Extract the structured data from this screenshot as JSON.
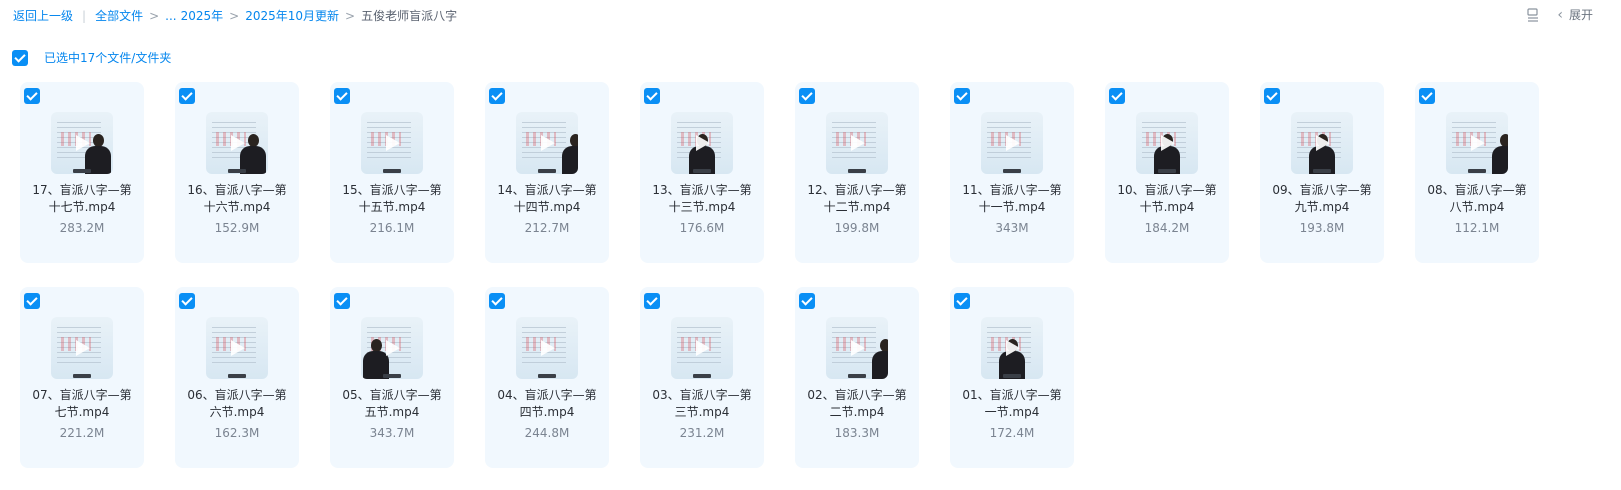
{
  "breadcrumb": {
    "back": "返回上一级",
    "all_files": "全部文件",
    "sep": ">",
    "ellipsis": "...",
    "year": "2025年",
    "month": "2025年10月更新",
    "current": "五俊老师盲派八字"
  },
  "toolbar": {
    "view_icon": "list-view-icon",
    "expand_chevron": "‹",
    "expand_label": "展开"
  },
  "selection": {
    "label": "已选中17个文件/文件夹",
    "checked": true
  },
  "files": [
    {
      "line1": "17、盲派八字—第",
      "line2": "十七节.mp4",
      "size": "283.2M",
      "person": "right"
    },
    {
      "line1": "16、盲派八字—第",
      "line2": "十六节.mp4",
      "size": "152.9M",
      "person": "right"
    },
    {
      "line1": "15、盲派八字—第",
      "line2": "十五节.mp4",
      "size": "216.1M",
      "person": "none"
    },
    {
      "line1": "14、盲派八字—第",
      "line2": "十四节.mp4",
      "size": "212.7M",
      "person": "edge"
    },
    {
      "line1": "13、盲派八字—第",
      "line2": "十三节.mp4",
      "size": "176.6M",
      "person": "center"
    },
    {
      "line1": "12、盲派八字—第",
      "line2": "十二节.mp4",
      "size": "199.8M",
      "person": "none"
    },
    {
      "line1": "11、盲派八字—第",
      "line2": "十一节.mp4",
      "size": "343M",
      "person": "none"
    },
    {
      "line1": "10、盲派八字—第",
      "line2": "十节.mp4",
      "size": "184.2M",
      "person": "center"
    },
    {
      "line1": "09、盲派八字—第",
      "line2": "九节.mp4",
      "size": "193.8M",
      "person": "center"
    },
    {
      "line1": "08、盲派八字—第",
      "line2": "八节.mp4",
      "size": "112.1M",
      "person": "edge"
    },
    {
      "line1": "07、盲派八字—第",
      "line2": "七节.mp4",
      "size": "221.2M",
      "person": "none"
    },
    {
      "line1": "06、盲派八字—第",
      "line2": "六节.mp4",
      "size": "162.3M",
      "person": "none"
    },
    {
      "line1": "05、盲派八字—第",
      "line2": "五节.mp4",
      "size": "343.7M",
      "person": "left"
    },
    {
      "line1": "04、盲派八字—第",
      "line2": "四节.mp4",
      "size": "244.8M",
      "person": "none"
    },
    {
      "line1": "03、盲派八字—第",
      "line2": "三节.mp4",
      "size": "231.2M",
      "person": "none"
    },
    {
      "line1": "02、盲派八字—第",
      "line2": "二节.mp4",
      "size": "183.3M",
      "person": "edge"
    },
    {
      "line1": "01、盲派八字—第",
      "line2": "一节.mp4",
      "size": "172.4M",
      "person": "center"
    }
  ],
  "colors": {
    "accent": "#0a8ff5",
    "card_bg": "#f1f8fe",
    "link": "#0687ee"
  }
}
